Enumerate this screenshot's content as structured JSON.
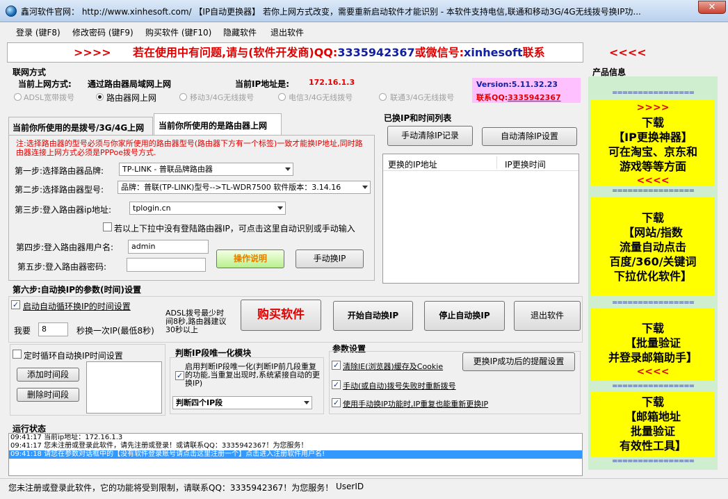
{
  "title": "鑫河软件官网： http://www.xinhesoft.com/ 【IP自动更换器】 若你上网方式改变，需要重新启动软件才能识别 - 本软件支持电信,联通和移动3G/4G无线拨号换IP功...",
  "menu": [
    "登录 (键F8)",
    "修改密码 (键F9)",
    "购买软件 (键F10)",
    "隐藏软件",
    "退出软件"
  ],
  "banner": {
    "arrows_left": ">>>>",
    "text_red": "若在使用中有问题,请与(软件开发商)QQ:",
    "qq": "3335942367",
    "text_mid": "或微信号:",
    "wechat": "xinhesoft",
    "text_end": "联系",
    "arrows_right": "<<<<"
  },
  "network": {
    "section": "联网方式",
    "mode_label": "当前上网方式:",
    "mode_value": "通过路由器局域网上网",
    "ip_label": "当前IP地址是:",
    "ip_value": "172.16.1.3",
    "version": "Version:5.11.32.23",
    "contact_label": "联系QQ:",
    "contact_qq": "3335942367",
    "options": [
      "ADSL宽带拨号",
      "路由器网上网",
      "移动3/4G无线拨号",
      "电信3/4G无线拨号",
      "联通3/4G无线拨号"
    ]
  },
  "tabs": [
    "当前你所使用的是拨号/3G/4G上网",
    "当前你所使用的是路由器上网"
  ],
  "router": {
    "note": "注:选择路由器的型号必须与你家所使用的路由器型号(路由器下方有一个标签)一致才能换IP地址,同时路由器连接上网方式必须是PPPoe拨号方式.",
    "step1": "第一步:选择路由器品牌:",
    "brand": "TP-LINK - 普联品牌路由器",
    "step2": "第二步:选择路由器型号:",
    "model": "品牌：普联(TP-LINK)型号-->TL-WDR7500 软件版本：3.14.16",
    "step3": "第三步:登入路由器ip地址:",
    "address": "tplogin.cn",
    "auto_detect": "若以上下拉中没有登陆路由器IP，可点击这里自动识别或手动输入",
    "step4": "第四步:登入路由器用户名:",
    "username": "admin",
    "step5": "第五步:登入路由器密码:",
    "password": "",
    "help_button": "操作说明",
    "manual_button": "手动换IP"
  },
  "ip_list": {
    "section": "已换IP和时间列表",
    "clear_manual": "手动清除IP记录",
    "clear_auto": "自动清除IP设置",
    "col_ip": "更换的IP地址",
    "col_time": "IP更换时间"
  },
  "step6": {
    "section": "第六步:自动换IP的参数(时间)设置",
    "auto_cycle": "启动自动循环换IP的时间设置",
    "i_want": "我要",
    "seconds": "8",
    "per_ip": "秒换一次IP(最低8秒)",
    "adsl_note": "ADSL拨号最少时间8秒,路由器建议30秒以上",
    "buy": "购买软件",
    "start": "开始自动换IP",
    "stop": "停止自动换IP",
    "exit": "退出软件"
  },
  "timer": {
    "label": "定时循环自动换IP时间设置",
    "add": "添加时间段",
    "delete": "删除时间段"
  },
  "unique": {
    "section": "判断IP段唯一化模块",
    "enable": "启用判断IP段唯一化(判断IP前几段重复的功能,当重复出现时,系统紧接自动的更换IP)",
    "select": "判断四个IP段"
  },
  "params": {
    "section": "参数设置",
    "clear_cache": "清除IE(浏览器)缓存及Cookie",
    "reminder": "更换IP成功后的提醒设置",
    "redial": "手动(或自动)拨号失败时重新拨号",
    "manual_repeat": "使用手动换IP功能时,IP重复也能重新更换IP"
  },
  "run_status": {
    "section": "运行状态",
    "lines": [
      "09:41:17 当前ip地址：172.16.1.3",
      "09:41:17 您未注册或登录此软件，请先注册或登录！或请联系QQ：3335942367！为您服务！",
      "09:41:18 请您在参数对话框中的【没有软件登录账号请点击这里注册一个】点击进入注册软件用户名!"
    ]
  },
  "product": {
    "section": "产品信息",
    "separator": "================",
    "items": [
      {
        "arrows_top": ">>>>",
        "lines": [
          "下载",
          "【IP更换神器】",
          "可在淘宝、京东和",
          "游戏等等方面"
        ],
        "arrows_bottom": "<<<<"
      },
      {
        "lines": [
          "下载",
          "【网站/指数",
          "流量自动点击",
          "百度/360/关键词",
          "下拉优化软件】"
        ]
      },
      {
        "lines": [
          "下载",
          "【批量验证",
          "并登录邮箱助手】"
        ],
        "arrows_bottom": "<<<<"
      },
      {
        "lines": [
          "下载",
          "【邮箱地址",
          "批量验证",
          "有效性工具】"
        ]
      }
    ]
  },
  "status": {
    "text": "您未注册或登录此软件，它的功能将受到限制，请联系QQ：3335942367！为您服务！",
    "user": "UserID"
  },
  "colors": {
    "accent_red": "#e00000",
    "accent_blue": "#1020a0",
    "promo_yellow": "#ffff00",
    "promo_green": "#cfeecf",
    "selected": "#3399ff"
  }
}
